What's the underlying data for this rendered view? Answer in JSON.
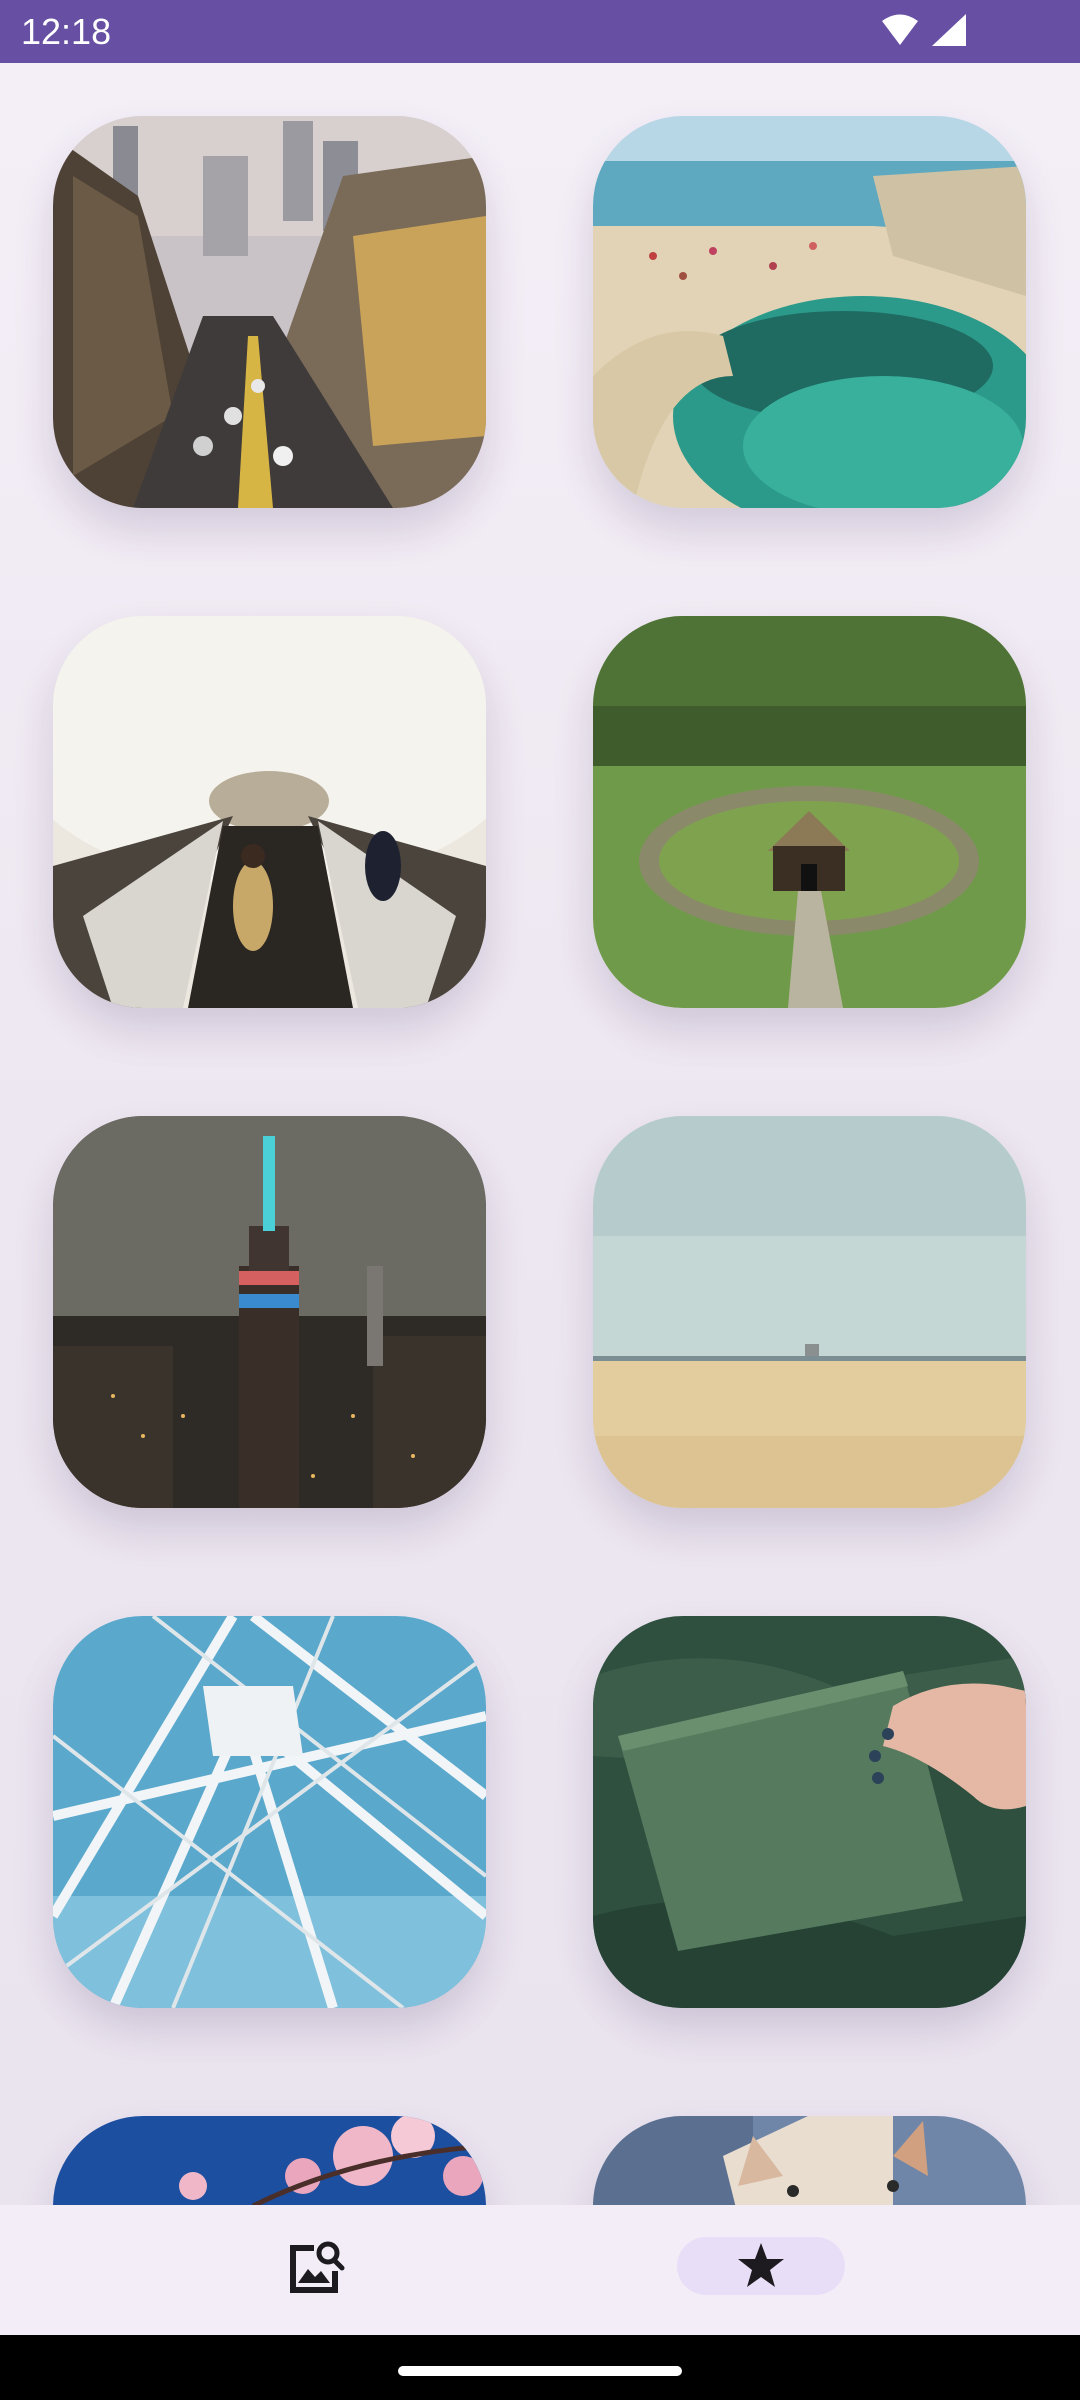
{
  "status_bar": {
    "time": "12:18",
    "icons": [
      "wifi-icon",
      "cellular-signal-icon"
    ],
    "background": "#6750a4"
  },
  "gallery": {
    "items": [
      {
        "subject": "city-street-photo"
      },
      {
        "subject": "coastal-grotto-photo"
      },
      {
        "subject": "escalator-tunnel-photo"
      },
      {
        "subject": "turf-house-photo"
      },
      {
        "subject": "skyline-at-night-photo"
      },
      {
        "subject": "empty-beach-photo"
      },
      {
        "subject": "ferris-wheel-photo"
      },
      {
        "subject": "green-notebook-photo"
      },
      {
        "subject": "cherry-blossom-photo"
      },
      {
        "subject": "kitten-photo"
      }
    ]
  },
  "bottom_nav": {
    "items": [
      {
        "icon": "image-search-icon",
        "selected": false
      },
      {
        "icon": "star-icon",
        "selected": true
      }
    ],
    "indicator_color": "#e8def8"
  }
}
